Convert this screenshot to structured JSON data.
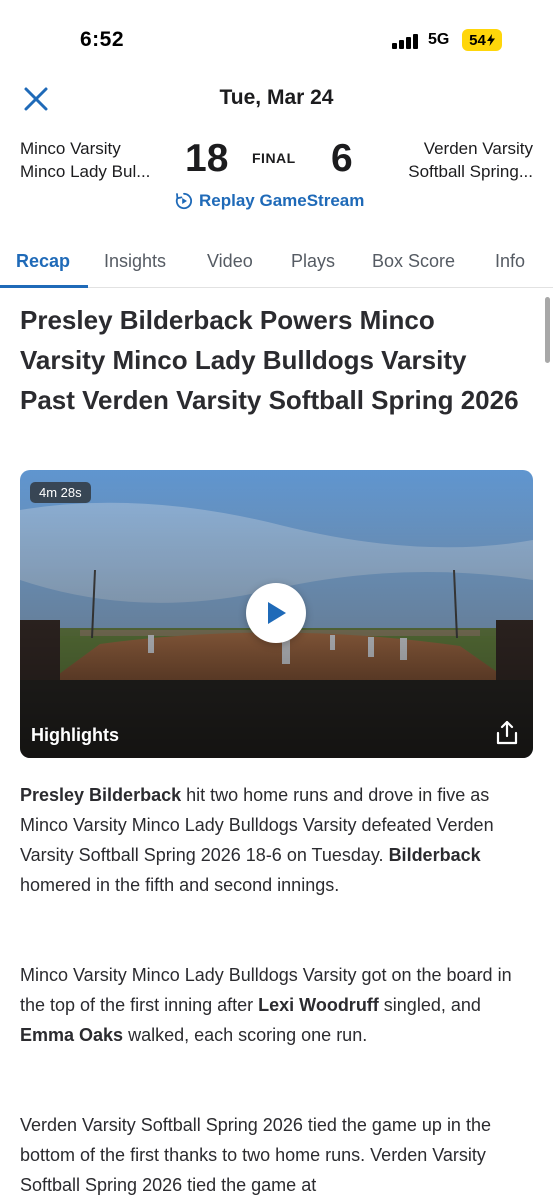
{
  "status_bar": {
    "time": "6:52",
    "network": "5G",
    "battery": "54"
  },
  "game": {
    "date": "Tue, Mar 24",
    "home_team": {
      "line1": "Minco Varsity",
      "line2": "Minco Lady Bul...",
      "score": "18"
    },
    "away_team": {
      "line1": "Verden Varsity",
      "line2": "Softball Spring...",
      "score": "6"
    },
    "status": "FINAL",
    "replay_label": "Replay GameStream"
  },
  "tabs": [
    {
      "label": "Recap",
      "active": true
    },
    {
      "label": "Insights",
      "active": false
    },
    {
      "label": "Video",
      "active": false
    },
    {
      "label": "Plays",
      "active": false
    },
    {
      "label": "Box Score",
      "active": false
    },
    {
      "label": "Info",
      "active": false
    }
  ],
  "article": {
    "headline": "Presley Bilderback Powers Minco Varsity Minco Lady Bulldogs Varsity Past Verden Varsity Softball Spring 2026",
    "video": {
      "duration": "4m 28s",
      "label": "Highlights"
    },
    "p1": {
      "b1": "Presley Bilderback",
      "t1": " hit two home runs and drove in five as Minco Varsity Minco Lady Bulldogs Varsity defeated Verden Varsity Softball Spring 2026 18-6 on Tuesday. ",
      "b2": "Bilderback",
      "t2": " homered in the fifth and second innings."
    },
    "p2": {
      "t1": "Minco Varsity Minco Lady Bulldogs Varsity got on the board in the top of the first inning after ",
      "b1": "Lexi Woodruff",
      "t2": " singled, and ",
      "b2": "Emma Oaks",
      "t3": " walked, each scoring one run."
    },
    "p3": {
      "t1": "Verden Varsity Softball Spring 2026 tied the game up in the bottom of the first thanks to two home runs. Verden Varsity Softball Spring 2026 tied the game at"
    }
  },
  "colors": {
    "accent": "#1f6ab8",
    "battery": "#ffd60a"
  }
}
